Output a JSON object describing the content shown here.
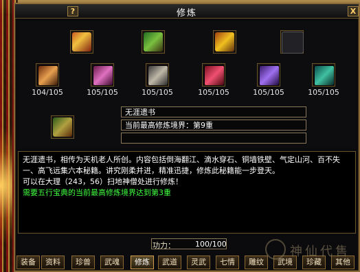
{
  "window": {
    "title": "修炼",
    "help_label": "?",
    "close_label": "X"
  },
  "top_items": [
    {
      "icon": "red-book-item-icon"
    },
    {
      "icon": "green-chest-item-icon"
    },
    {
      "icon": "gold-treasure-item-icon"
    },
    {
      "icon": "empty-slot-icon"
    }
  ],
  "scrolls": [
    {
      "icon": "orange-scroll-icon",
      "count": "104/105"
    },
    {
      "icon": "pink-scroll-icon",
      "count": "105/105"
    },
    {
      "icon": "white-scroll-icon",
      "count": "105/105"
    },
    {
      "icon": "red-scroll-icon",
      "count": "105/105"
    },
    {
      "icon": "purple-scroll-icon",
      "count": "105/105"
    },
    {
      "icon": "teal-scroll-icon",
      "count": "105/105"
    }
  ],
  "book": {
    "name": "无涯遗书",
    "realm": "当前最高修炼境界：第9重",
    "extra": ""
  },
  "description": {
    "text": "无涯遗书，相传为天机老人所创。内容包括倒海翻江、滴水穿石、铜墙铁壁、气定山河、百不失一、高飞远集六本秘籍。讲究刚柔并进，精准迅捷，修炼此秘籍能一步登天。",
    "location": "可以在大理（243，56）扫地神僧处进行修炼！",
    "requirement": "需要五行宝典的当前最高修炼境界达到第3重"
  },
  "power": {
    "label": "功力：",
    "value": "100/100"
  },
  "tabs": [
    "装备",
    "资料",
    "珍兽",
    "武魂",
    "修炼",
    "武道",
    "灵武",
    "七情",
    "雕纹",
    "武境",
    "珍藏",
    "其他"
  ],
  "active_tab": "修炼",
  "watermark": {
    "text": "神仙代售"
  },
  "colors": {
    "border": "#8a6a36",
    "requirement_text": "#40ff40"
  }
}
